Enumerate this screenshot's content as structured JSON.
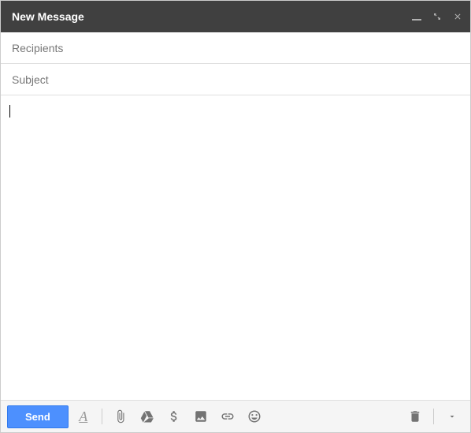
{
  "header": {
    "title": "New Message"
  },
  "fields": {
    "recipients_placeholder": "Recipients",
    "recipients_value": "",
    "subject_placeholder": "Subject",
    "subject_value": ""
  },
  "body": {
    "value": ""
  },
  "toolbar": {
    "send_label": "Send",
    "format_label": "A"
  }
}
